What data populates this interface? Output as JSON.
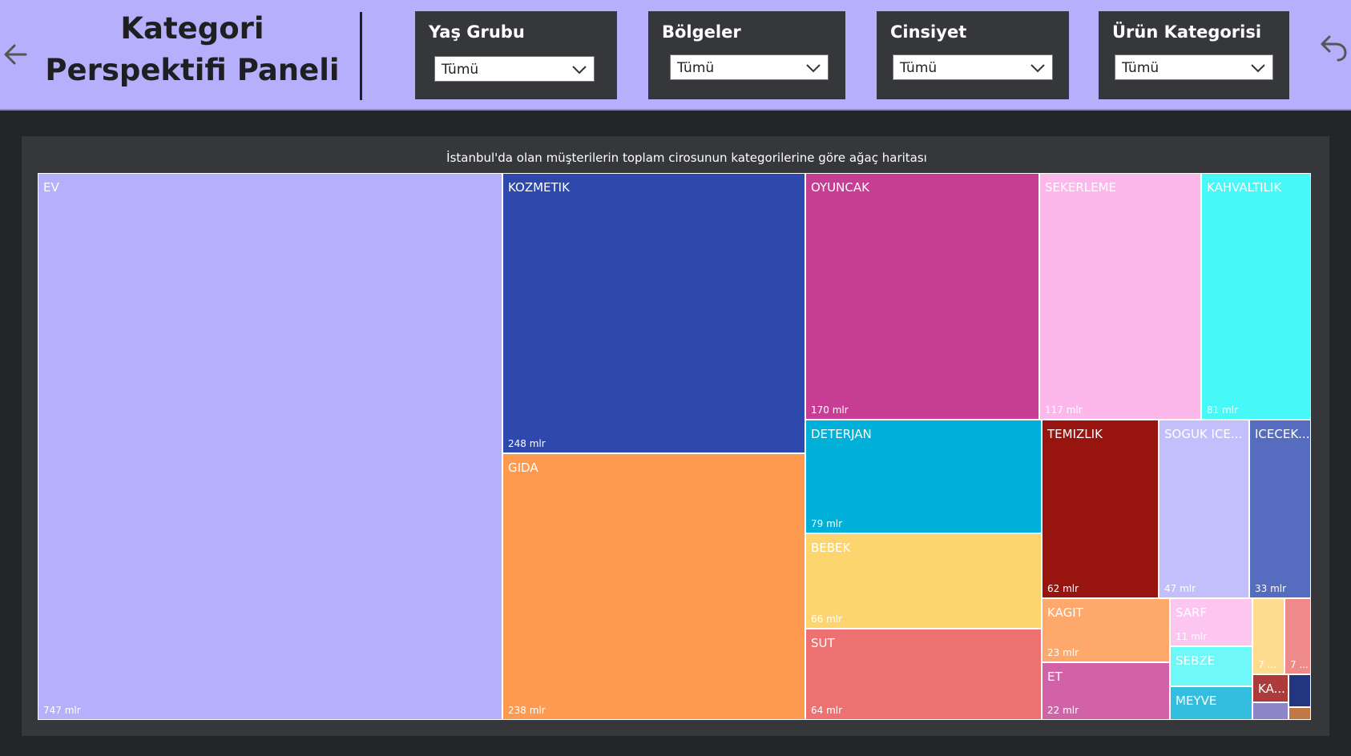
{
  "header": {
    "title": "Kategori Perspektifi Paneli",
    "back_icon": "arrow-left-icon",
    "undo_icon": "undo-arrow-icon"
  },
  "filters": [
    {
      "label": "Yaş Grubu",
      "value": "Tümü"
    },
    {
      "label": "Bölgeler",
      "value": "Tümü"
    },
    {
      "label": "Cinsiyet",
      "value": "Tümü"
    },
    {
      "label": "Ürün Kategorisi",
      "value": "Tümü"
    }
  ],
  "colors": {
    "header_bg": "#b6b0fc",
    "page_bg": "#232528",
    "panel_bg": "#35373b"
  },
  "chart_data": {
    "type": "treemap",
    "title": "İstanbul'da olan müşterilerin toplam cirosunun kategorilerine göre ağaç haritası",
    "unit": "mlr",
    "items": [
      {
        "name": "EV",
        "value": 747,
        "label": "747 mlr",
        "color": "#b5b0fc"
      },
      {
        "name": "KOZMETIK",
        "value": 248,
        "label": "248 mlr",
        "color": "#2e48ab"
      },
      {
        "name": "GIDA",
        "value": 238,
        "label": "238 mlr",
        "color": "#fe9a4f"
      },
      {
        "name": "OYUNCAK",
        "value": 170,
        "label": "170 mlr",
        "color": "#c73d93"
      },
      {
        "name": "SEKERLEME",
        "value": 117,
        "label": "117 mlr",
        "color": "#fdb8eb"
      },
      {
        "name": "KAHVALTILIK",
        "value": 81,
        "label": "81 mlr",
        "color": "#46f8f8"
      },
      {
        "name": "DETERJAN",
        "value": 79,
        "label": "79 mlr",
        "color": "#00b0d8"
      },
      {
        "name": "BEBEK",
        "value": 66,
        "label": "66 mlr",
        "color": "#fdd56f"
      },
      {
        "name": "SUT",
        "value": 64,
        "label": "64 mlr",
        "color": "#ee7171"
      },
      {
        "name": "TEMIZLIK",
        "value": 62,
        "label": "62 mlr",
        "color": "#98140e"
      },
      {
        "name": "SOGUK ICE...",
        "value": 47,
        "label": "47 mlr",
        "color": "#c3bffc"
      },
      {
        "name": "ICECEK...",
        "value": 33,
        "label": "33 mlr",
        "color": "#566cbf"
      },
      {
        "name": "KAGIT",
        "value": 23,
        "label": "23 mlr",
        "color": "#fea86b"
      },
      {
        "name": "ET",
        "value": 22,
        "label": "22 mlr",
        "color": "#d262a8"
      },
      {
        "name": "SARF",
        "value": 11,
        "label": "11 mlr",
        "color": "#fcc6f1"
      },
      {
        "name": "SEBZE",
        "value": null,
        "label": "",
        "color": "#6ff8f8"
      },
      {
        "name": "MEYVE",
        "value": null,
        "label": "",
        "color": "#33bee0"
      },
      {
        "name": "",
        "value": 7,
        "label": "7 ...",
        "color": "#fddc8f"
      },
      {
        "name": "",
        "value": 7,
        "label": "7 ...",
        "color": "#ee8a8a"
      },
      {
        "name": "KA...",
        "value": null,
        "label": "",
        "color": "#ae3b3b"
      },
      {
        "name": "",
        "value": null,
        "label": "",
        "color": "#223580"
      },
      {
        "name": "",
        "value": null,
        "label": "",
        "color": "#8c86c8"
      },
      {
        "name": "",
        "value": null,
        "label": "",
        "color": "#c27844"
      }
    ]
  }
}
